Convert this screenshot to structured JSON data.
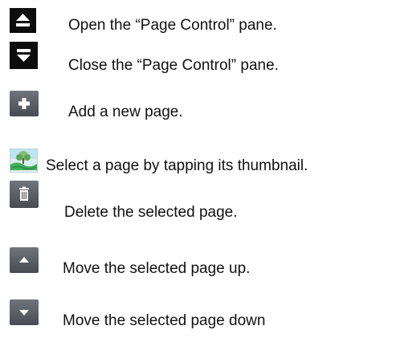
{
  "legend": {
    "open_label": "Open the “Page Control” pane.",
    "close_label": "Close the “Page Control” pane.",
    "add_label": "Add a new page.",
    "select_label": "Select a page by tapping its thumbnail.",
    "delete_label": "Delete the selected page.",
    "up_label": "Move the selected page up.",
    "down_label": "Move the selected page down"
  },
  "icons": {
    "open": "eject-up-icon",
    "close": "eject-down-icon",
    "add": "plus-icon",
    "select": "page-thumbnail-icon",
    "delete": "trash-icon",
    "up": "triangle-up-icon",
    "down": "triangle-down-icon"
  },
  "colors": {
    "black_button": "#0d0d0d",
    "grey_button": "#5a5e65",
    "glyph": "#ffffff",
    "thumbnail_green": "#3fae5a",
    "thumbnail_sky": "#bfe3f0"
  }
}
